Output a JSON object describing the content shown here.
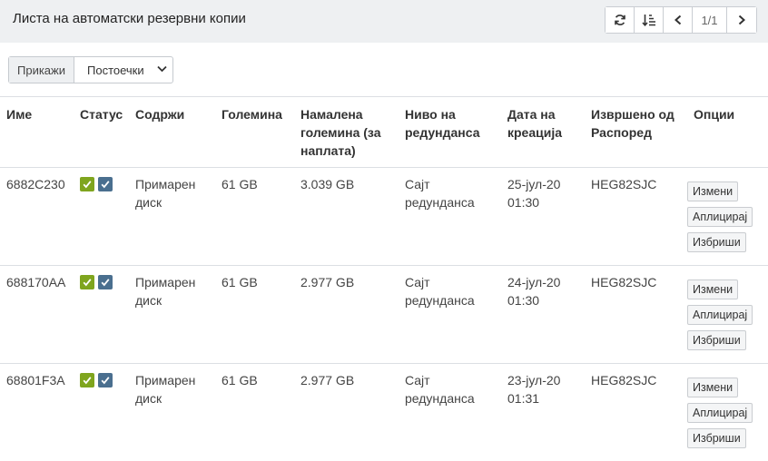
{
  "header": {
    "title": "Листа на автоматски резервни копии",
    "page_indicator": "1/1",
    "icons": [
      "refresh-icon",
      "sort-icon",
      "chevron-left-icon",
      "chevron-right-icon"
    ]
  },
  "filter": {
    "label": "Прикажи",
    "selected": "Постоечки"
  },
  "table": {
    "columns": [
      "Име",
      "Статус",
      "Содржи",
      "Големина",
      "Намалена големина (за наплата)",
      "Ниво на редунданса",
      "Дата на креација",
      "Извршено од Распоред",
      "Опции"
    ],
    "rows": [
      {
        "name": "6882C230",
        "contains": "Примарен диск",
        "size": "61 GB",
        "reduced_size": "3.039 GB",
        "redundancy": "Сајт редунданса",
        "created": "25-јул-20 01:30",
        "schedule": "HEG82SJC"
      },
      {
        "name": "688170AA",
        "contains": "Примарен диск",
        "size": "61 GB",
        "reduced_size": "2.977 GB",
        "redundancy": "Сајт редунданса",
        "created": "24-јул-20 01:30",
        "schedule": "HEG82SJC"
      },
      {
        "name": "68801F3A",
        "contains": "Примарен диск",
        "size": "61 GB",
        "reduced_size": "2.977 GB",
        "redundancy": "Сајт редунданса",
        "created": "23-јул-20 01:31",
        "schedule": "HEG82SJC"
      }
    ],
    "options": {
      "edit": "Измени",
      "apply": "Аплицирај",
      "delete": "Избриши"
    }
  },
  "colors": {
    "status_green": "#7fa51e",
    "status_blue": "#4a6f8f",
    "header_bg": "#eef0f2"
  }
}
